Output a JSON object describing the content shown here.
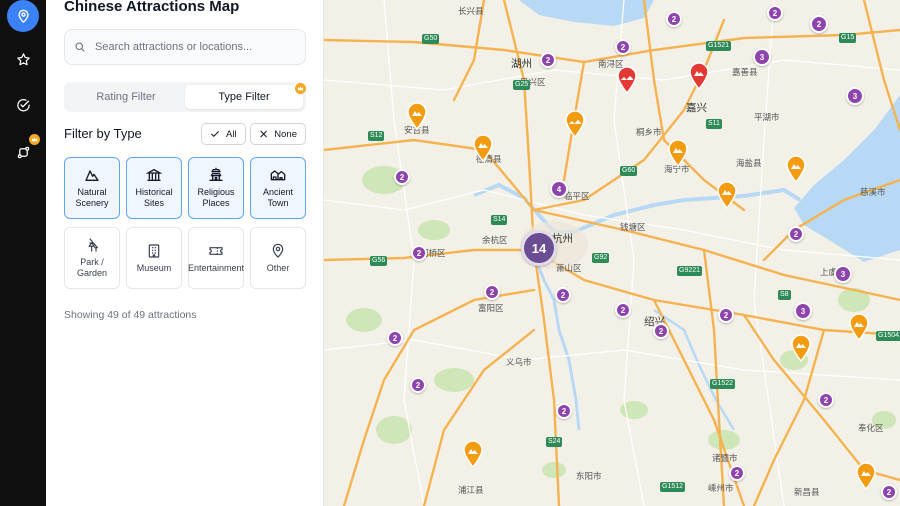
{
  "app": {
    "title": "Chinese Attractions Map"
  },
  "rail": {
    "items": [
      {
        "icon": "map-pin-icon",
        "active": true
      },
      {
        "icon": "star-icon",
        "active": false
      },
      {
        "icon": "check-circle-icon",
        "active": false
      },
      {
        "icon": "route-icon",
        "active": false,
        "badge": "crown-icon"
      }
    ]
  },
  "search": {
    "placeholder": "Search attractions or locations..."
  },
  "tabs": [
    {
      "label": "Rating Filter",
      "active": false
    },
    {
      "label": "Type Filter",
      "active": true,
      "badge": "crown-icon"
    }
  ],
  "filter": {
    "title": "Filter by Type",
    "all_label": "All",
    "none_label": "None"
  },
  "types": [
    {
      "label": "Natural Scenery",
      "icon": "mountain-icon",
      "selected": true
    },
    {
      "label": "Historical Sites",
      "icon": "bank-icon",
      "selected": true
    },
    {
      "label": "Religious Places",
      "icon": "pagoda-icon",
      "selected": true
    },
    {
      "label": "Ancient Town",
      "icon": "ancient-town-icon",
      "selected": true
    },
    {
      "label": "Park / Garden",
      "icon": "tree-icon",
      "selected": false
    },
    {
      "label": "Museum",
      "icon": "museum-icon",
      "selected": false
    },
    {
      "label": "Entertainment",
      "icon": "ticket-icon",
      "selected": false
    },
    {
      "label": "Other",
      "icon": "location-icon",
      "selected": false
    }
  ],
  "status": {
    "showing": "Showing 49 of 49 attractions"
  },
  "colors": {
    "accent": "#3b82f6",
    "cluster": "#8e44ad",
    "cluster_large": "#6b4d94",
    "pin_orange": "#f39c12",
    "pin_red": "#e53935",
    "water": "#b8d9f5",
    "badge": "#f5a623"
  },
  "map": {
    "city_labels": [
      "湖州",
      "嘉兴",
      "杭州",
      "绍兴"
    ],
    "place_labels": [
      "南浔区",
      "安吉县",
      "德清县",
      "桐乡市",
      "海宁市",
      "临平区",
      "余杭区",
      "萧山区",
      "富阳区",
      "钱塘区",
      "柯桥区",
      "海盐县",
      "平湖市",
      "嘉善县",
      "上虞区",
      "诸暨市",
      "浦江县",
      "嵊州市",
      "新昌县",
      "奉化区",
      "慈溪市",
      "吴兴区",
      "长兴县",
      "义乌市",
      "东阳市"
    ],
    "road_shields": [
      "G50",
      "G25",
      "G1521",
      "G15",
      "S12",
      "S11",
      "G60",
      "G92",
      "S14",
      "G56",
      "G9221",
      "S8",
      "G1504",
      "G1522",
      "G1512",
      "S24"
    ],
    "clusters": [
      {
        "count": "2"
      },
      {
        "count": "2"
      },
      {
        "count": "2"
      },
      {
        "count": "2"
      },
      {
        "count": "3"
      },
      {
        "count": "2"
      },
      {
        "count": "3"
      },
      {
        "count": "3"
      },
      {
        "count": "2"
      },
      {
        "count": "4"
      },
      {
        "count": "14"
      },
      {
        "count": "2"
      },
      {
        "count": "2"
      },
      {
        "count": "2"
      },
      {
        "count": "2"
      },
      {
        "count": "2"
      },
      {
        "count": "3"
      },
      {
        "count": "2"
      },
      {
        "count": "3"
      },
      {
        "count": "2"
      },
      {
        "count": "2"
      },
      {
        "count": "2"
      },
      {
        "count": "2"
      },
      {
        "count": "2"
      },
      {
        "count": "2"
      },
      {
        "count": "2"
      }
    ]
  }
}
